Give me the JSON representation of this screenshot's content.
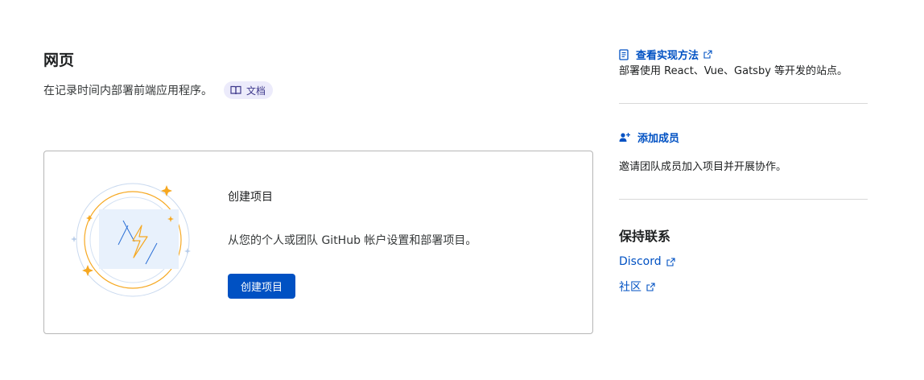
{
  "header": {
    "title": "网页",
    "subtitle": "在记录时间内部署前端应用程序。",
    "docs_label": "文档"
  },
  "card": {
    "title": "创建项目",
    "description": "从您的个人或团队 GitHub 帐户设置和部署项目。",
    "button_label": "创建项目"
  },
  "sidebar": {
    "howto": {
      "label": "查看实现方法",
      "description": "部署使用 React、Vue、Gatsby 等开发的站点。"
    },
    "members": {
      "label": "添加成员",
      "description": "邀请团队成员加入项目并开展协作。"
    },
    "contact": {
      "title": "保持联系",
      "links": [
        {
          "label": "Discord"
        },
        {
          "label": "社区"
        }
      ]
    }
  },
  "colors": {
    "accent": "#0051c3",
    "pill_bg": "#ecebfb",
    "card_border": "#b6b6b6",
    "illustration_orange": "#f6a821"
  }
}
